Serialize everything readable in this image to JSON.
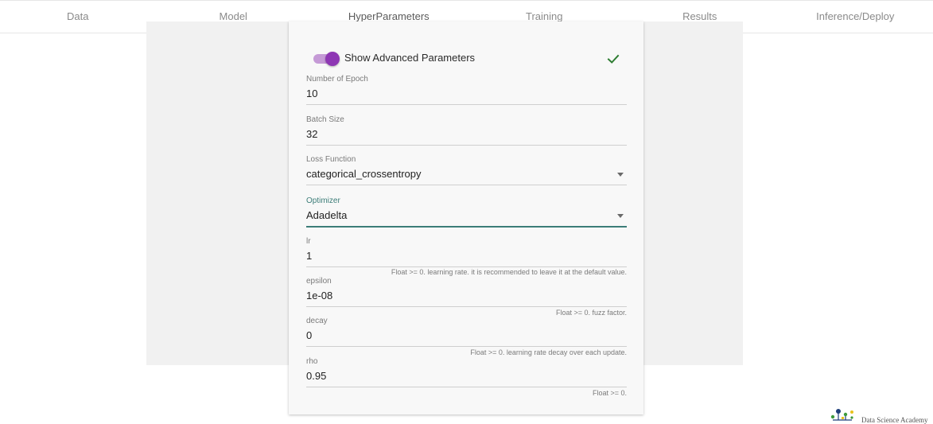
{
  "tabs": [
    {
      "label": "Data",
      "active": false
    },
    {
      "label": "Model",
      "active": false
    },
    {
      "label": "HyperParameters",
      "active": true
    },
    {
      "label": "Training",
      "active": false
    },
    {
      "label": "Results",
      "active": false
    },
    {
      "label": "Inference/Deploy",
      "active": false
    }
  ],
  "toggle": {
    "label": "Show Advanced Parameters",
    "on": true
  },
  "fields": {
    "epochs": {
      "label": "Number of Epoch",
      "value": "10"
    },
    "batch_size": {
      "label": "Batch Size",
      "value": "32"
    },
    "loss": {
      "label": "Loss Function",
      "value": "categorical_crossentropy"
    },
    "optimizer": {
      "label": "Optimizer",
      "value": "Adadelta"
    },
    "lr": {
      "label": "lr",
      "value": "1",
      "hint": "Float >= 0. learning rate. it is recommended to leave it at the default value."
    },
    "epsilon": {
      "label": "epsilon",
      "value": "1e-08",
      "hint": "Float >= 0. fuzz factor."
    },
    "decay": {
      "label": "decay",
      "value": "0",
      "hint": "Float >= 0. learning rate decay over each update."
    },
    "rho": {
      "label": "rho",
      "value": "0.95",
      "hint": "Float >= 0."
    }
  },
  "brand": {
    "name": "Data Science Academy"
  },
  "colors": {
    "accent": "#3c7d78",
    "toggle": "#8e37b4",
    "check": "#2e7d32"
  },
  "icons": {
    "toggle": "toggle-switch-icon",
    "check": "checkmark-icon",
    "dropdown": "chevron-down-icon",
    "logo": "data-science-academy-logo"
  }
}
